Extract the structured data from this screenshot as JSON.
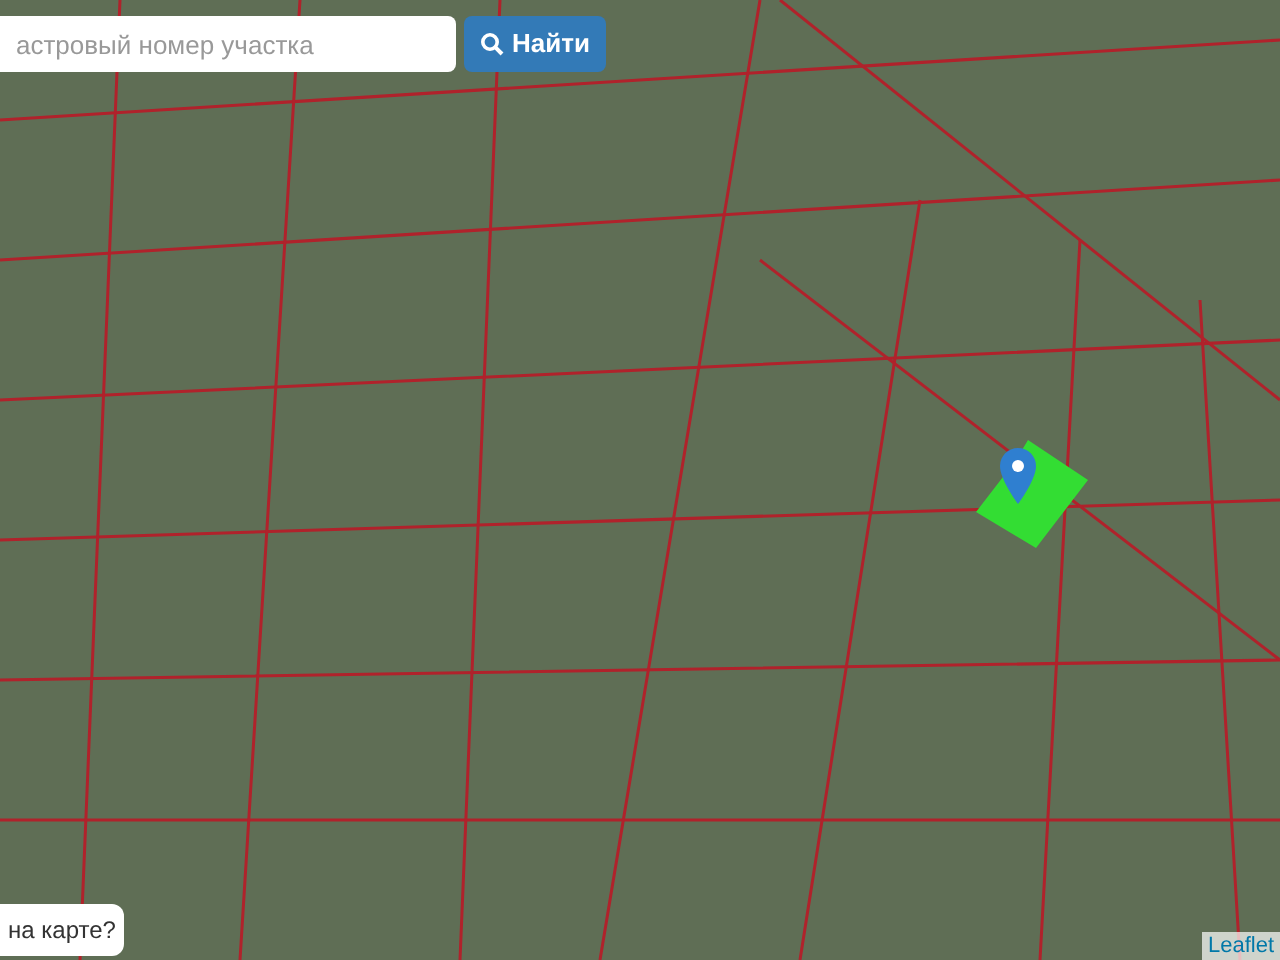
{
  "search": {
    "placeholder": "астровый номер участка",
    "button": "Найти"
  },
  "map": {
    "selected_plot": {
      "color": "#33dd33"
    }
  },
  "help_box": {
    "text": "на карте?"
  },
  "attribution": {
    "link": "Leaflet"
  }
}
